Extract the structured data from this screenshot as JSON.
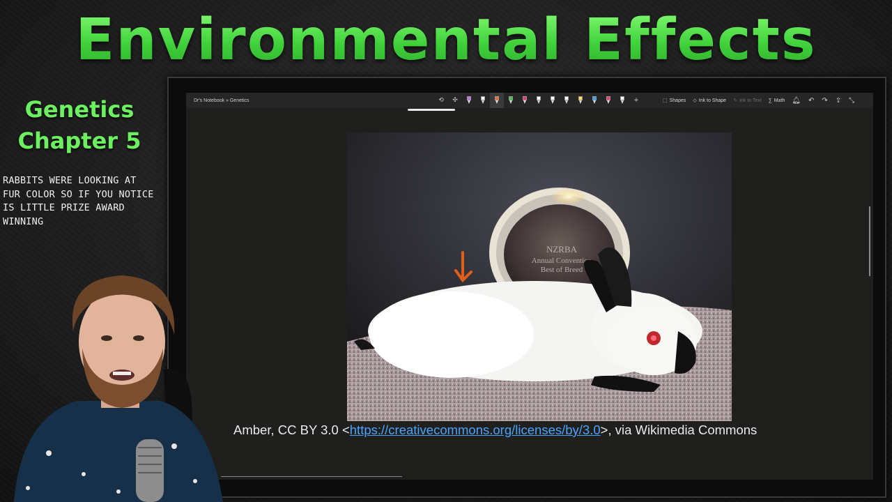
{
  "video": {
    "title": "Environmental Effects",
    "subject": "Genetics",
    "chapter": "Chapter 5",
    "notes": [
      "Rabbits were looking at",
      "fur color so if you notice",
      "is little prize award",
      "winning"
    ]
  },
  "onenote": {
    "breadcrumb": "Dr's Notebook » Genetics",
    "toolbar": {
      "pens": [
        "#c070ff",
        "#ffffff",
        "#ff6a2a",
        "#36d13a",
        "#ff2a7a",
        "#ffffff",
        "#ffffff",
        "#ffffff",
        "#ffe04a",
        "#2aa8ff",
        "#ff3a6a",
        "#ffffff"
      ],
      "shapes_label": "Shapes",
      "ink_to_shape_label": "Ink to Shape",
      "ink_to_text_label": "Ink to Text",
      "math_label": "Math"
    },
    "image": {
      "plaque_line1": "NZRBA",
      "plaque_line2": "Annual Convention",
      "plaque_line3": "Best of Breed"
    },
    "caption": {
      "prefix": "Amber, CC BY 3.0 <",
      "link": "https://creativecommons.org/licenses/by/3.0",
      "suffix": ">, via Wikimedia Commons"
    },
    "annotation_color": "#e0601a"
  },
  "colors": {
    "title_green": "#6cf060",
    "link_blue": "#4aa3ff"
  }
}
